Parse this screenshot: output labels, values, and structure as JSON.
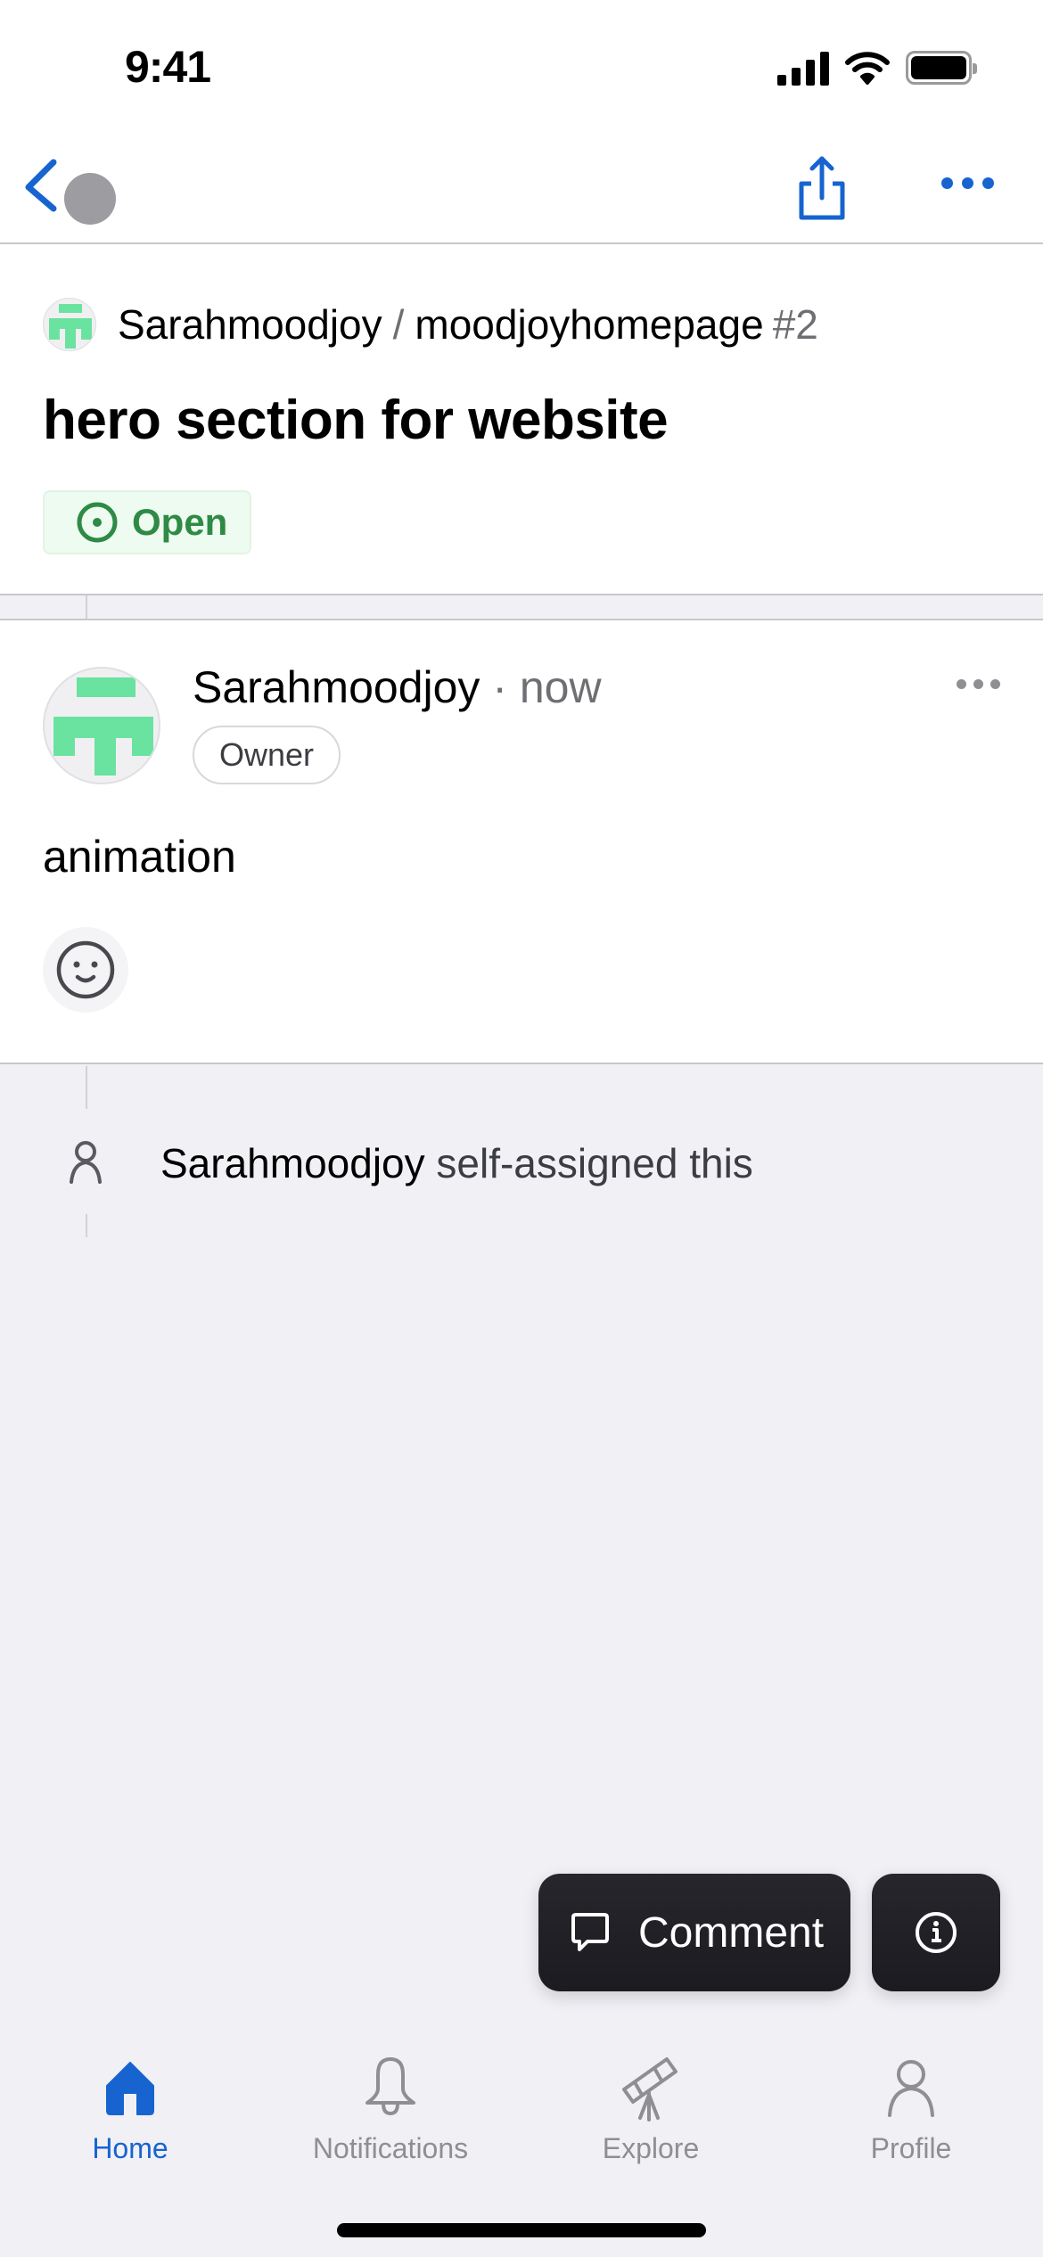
{
  "status_bar": {
    "time": "9:41"
  },
  "nav": {
    "back_label": "Back",
    "share_label": "Share",
    "more_label": "More"
  },
  "issue": {
    "owner": "Sarahmoodjoy",
    "separator": "/",
    "repo": "moodjoyhomepage",
    "number": "#2",
    "title": "hero section for website",
    "state": "Open"
  },
  "comment": {
    "author": "Sarahmoodjoy",
    "time": "· now",
    "role_badge": "Owner",
    "body": "animation"
  },
  "events": [
    {
      "actor": "Sarahmoodjoy",
      "action": "self-assigned this",
      "icon": "person-icon"
    }
  ],
  "actions": {
    "comment_label": "Comment",
    "info_label": "Info"
  },
  "tab_bar": {
    "items": [
      {
        "label": "Home",
        "icon": "home-icon",
        "active": true
      },
      {
        "label": "Notifications",
        "icon": "bell-icon",
        "active": false
      },
      {
        "label": "Explore",
        "icon": "telescope-icon",
        "active": false
      },
      {
        "label": "Profile",
        "icon": "person-icon",
        "active": false
      }
    ]
  },
  "colors": {
    "accent": "#1764d0",
    "open_green": "#2e8a45",
    "open_bg": "#eefbf0",
    "avatar_green": "#6ae3a0",
    "background": "#f0f0f5"
  }
}
